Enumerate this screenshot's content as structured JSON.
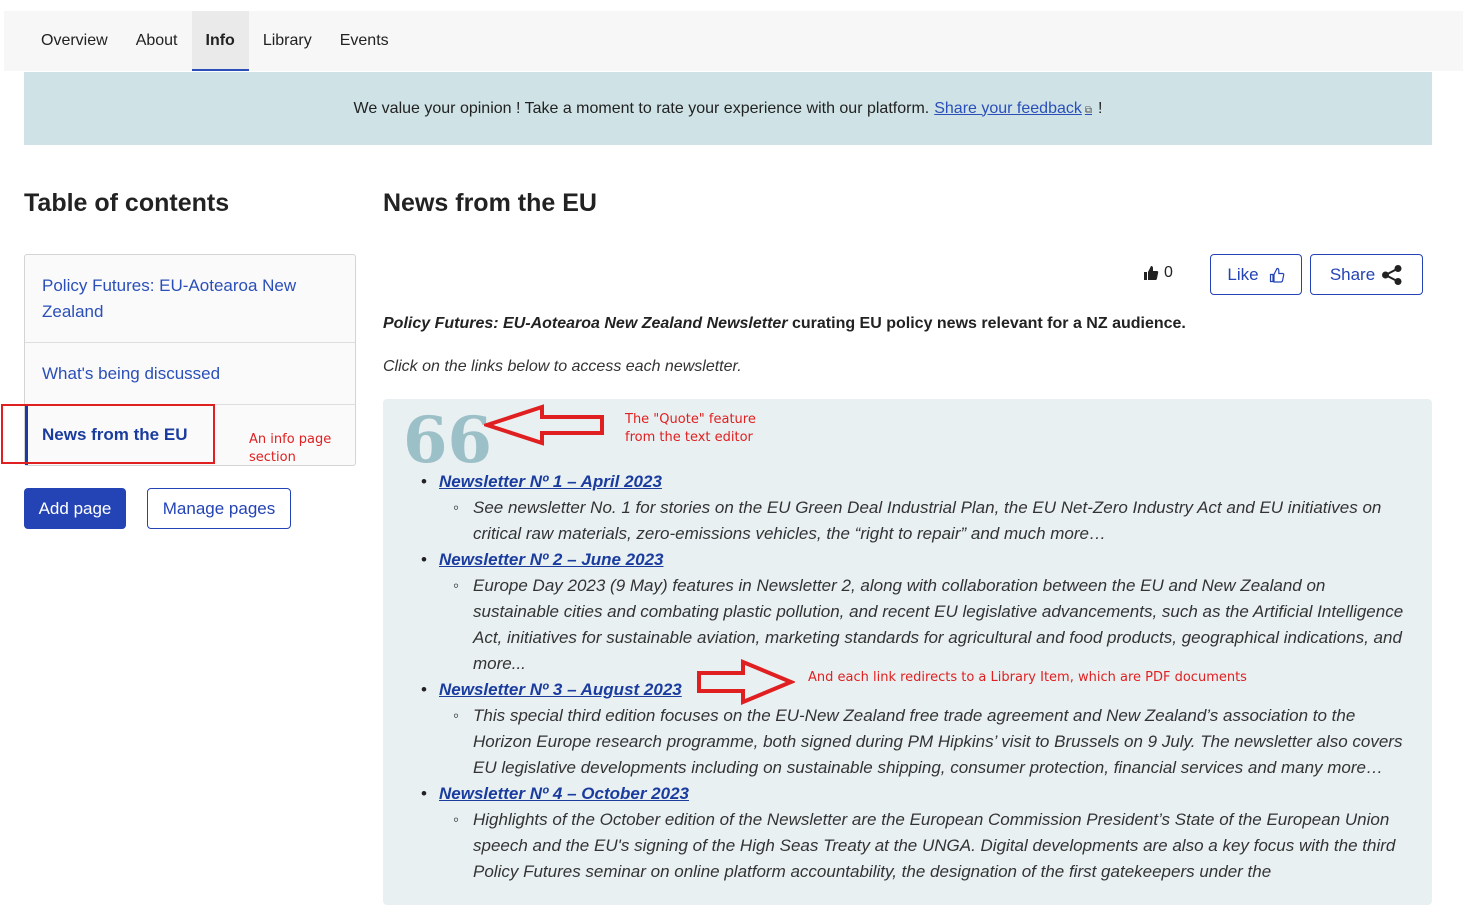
{
  "tabs": [
    {
      "label": "Overview",
      "active": false
    },
    {
      "label": "About",
      "active": false
    },
    {
      "label": "Info",
      "active": true
    },
    {
      "label": "Library",
      "active": false
    },
    {
      "label": "Events",
      "active": false
    }
  ],
  "banner": {
    "text": "We value your opinion ! Take a moment to rate your experience with our platform.",
    "link": "Share your feedback",
    "tail": "!"
  },
  "toc": {
    "title": "Table of contents",
    "items": [
      {
        "label": "Policy Futures: EU-Aotearoa New Zealand"
      },
      {
        "label": "What's being discussed"
      },
      {
        "label": "News from the EU",
        "active": true
      }
    ],
    "add_page": "Add page",
    "manage_pages": "Manage pages"
  },
  "main": {
    "title": "News from the EU",
    "like_count": "0",
    "like_label": "Like",
    "share_label": "Share",
    "intro_em": "Policy Futures: EU-Aotearoa New Zealand Newsletter",
    "intro_rest": " curating EU policy news relevant for a NZ audience.",
    "sub": "Click on the links below to access each newsletter.",
    "quote_mark": "66",
    "newsletters": [
      {
        "link": "Newsletter Nº 1 – April 2023",
        "desc": "See newsletter No. 1 for stories on the EU Green Deal Industrial Plan, the EU Net-Zero Industry Act and EU initiatives on critical raw materials, zero-emissions vehicles, the “right to repair” and much more…"
      },
      {
        "link": "Newsletter Nº 2 – June 2023",
        "desc": "Europe Day 2023 (9 May) features in Newsletter 2, along with collaboration between the EU and New Zealand on sustainable cities and combating plastic pollution, and recent EU legislative advancements, such as the Artificial Intelligence Act, initiatives for sustainable aviation, marketing standards for agricultural and food products, geographical indications, and more..."
      },
      {
        "link": "Newsletter Nº 3 – August 2023",
        "desc": "This special third edition focuses on the EU-New Zealand free trade agreement and New Zealand’s association to the Horizon Europe research programme, both signed during PM Hipkins’ visit to Brussels on 9 July. The newsletter also covers EU legislative developments including on sustainable shipping, consumer protection, financial services and many more…"
      },
      {
        "link": "Newsletter Nº 4 – October 2023",
        "desc": "Highlights of the October edition of the Newsletter are the European Commission President’s State of the European Union speech and the EU's signing of the High Seas Treaty at the UNGA. Digital developments are also a key focus with the third Policy Futures seminar on online platform accountability, the designation of the first gatekeepers under the"
      }
    ]
  },
  "annotations": {
    "info_page": "An info page section",
    "quote_feature_line1": "The \"Quote\" feature",
    "quote_feature_line2": "from the text editor",
    "link_note": "And each link redirects to a Library Item, which are PDF documents"
  },
  "colors": {
    "accent": "#2443b5",
    "banner_bg": "#cfe3e6",
    "quote_bg": "#e9f0f2",
    "annotation": "#e02020"
  }
}
